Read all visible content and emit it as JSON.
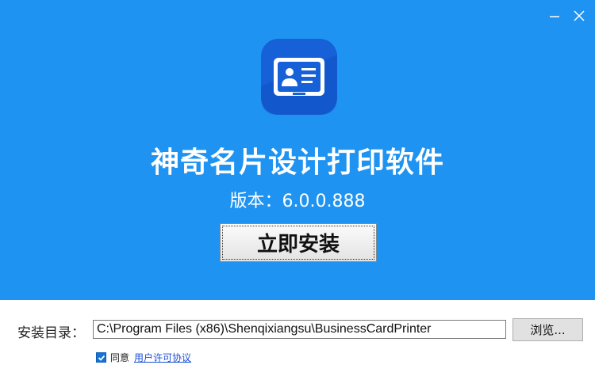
{
  "window": {
    "minimize_icon": "minimize-icon",
    "close_icon": "close-icon"
  },
  "app": {
    "icon": "business-card-icon",
    "title": "神奇名片设计打印软件",
    "version": "版本：6.0.0.888",
    "install_label": "立即安装"
  },
  "install_dir": {
    "label": "安装目录：",
    "value": "C:\\Program Files (x86)\\Shenqixiangsu\\BusinessCardPrinter",
    "browse_label": "浏览..."
  },
  "agreement": {
    "checked": true,
    "text": "同意",
    "link_label": "用户许可协议"
  },
  "colors": {
    "primary_blue": "#1f93f1",
    "icon_dark_blue": "#1660d8",
    "link_blue": "#1a4fd6"
  }
}
